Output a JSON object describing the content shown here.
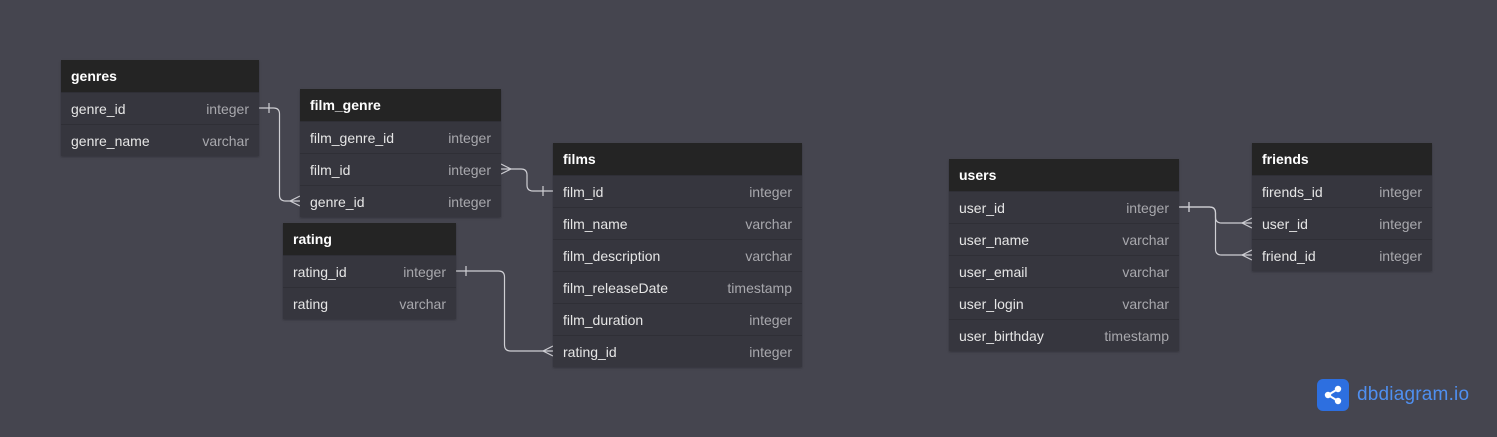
{
  "colors": {
    "canvas": "#45454f",
    "table_body": "#36363e",
    "table_header": "#242424",
    "link": "#cfcfd4",
    "brand": "#2d6fe0"
  },
  "tables": [
    {
      "id": "genres",
      "name": "genres",
      "fields": [
        {
          "name": "genre_id",
          "type": "integer"
        },
        {
          "name": "genre_name",
          "type": "varchar"
        }
      ]
    },
    {
      "id": "film_genre",
      "name": "film_genre",
      "fields": [
        {
          "name": "film_genre_id",
          "type": "integer"
        },
        {
          "name": "film_id",
          "type": "integer"
        },
        {
          "name": "genre_id",
          "type": "integer"
        }
      ]
    },
    {
      "id": "rating",
      "name": "rating",
      "fields": [
        {
          "name": "rating_id",
          "type": "integer"
        },
        {
          "name": "rating",
          "type": "varchar"
        }
      ]
    },
    {
      "id": "films",
      "name": "films",
      "fields": [
        {
          "name": "film_id",
          "type": "integer"
        },
        {
          "name": "film_name",
          "type": "varchar"
        },
        {
          "name": "film_description",
          "type": "varchar"
        },
        {
          "name": "film_releaseDate",
          "type": "timestamp"
        },
        {
          "name": "film_duration",
          "type": "integer"
        },
        {
          "name": "rating_id",
          "type": "integer"
        }
      ]
    },
    {
      "id": "users",
      "name": "users",
      "fields": [
        {
          "name": "user_id",
          "type": "integer"
        },
        {
          "name": "user_name",
          "type": "varchar"
        },
        {
          "name": "user_email",
          "type": "varchar"
        },
        {
          "name": "user_login",
          "type": "varchar"
        },
        {
          "name": "user_birthday",
          "type": "timestamp"
        }
      ]
    },
    {
      "id": "friends",
      "name": "friends",
      "fields": [
        {
          "name": "firends_id",
          "type": "integer"
        },
        {
          "name": "user_id",
          "type": "integer"
        },
        {
          "name": "friend_id",
          "type": "integer"
        }
      ]
    }
  ],
  "relations": [
    {
      "from": "genres.genre_id",
      "to": "film_genre.genre_id",
      "from_card": "one",
      "to_card": "many"
    },
    {
      "from": "films.film_id",
      "to": "film_genre.film_id",
      "from_card": "one",
      "to_card": "many"
    },
    {
      "from": "rating.rating_id",
      "to": "films.rating_id",
      "from_card": "one",
      "to_card": "many"
    },
    {
      "from": "users.user_id",
      "to": "friends.user_id",
      "from_card": "one",
      "to_card": "many"
    },
    {
      "from": "users.user_id",
      "to": "friends.friend_id",
      "from_card": "one",
      "to_card": "many"
    }
  ],
  "brand": {
    "logo_text": "dbdiagram.io",
    "icon": "share-nodes-icon"
  }
}
